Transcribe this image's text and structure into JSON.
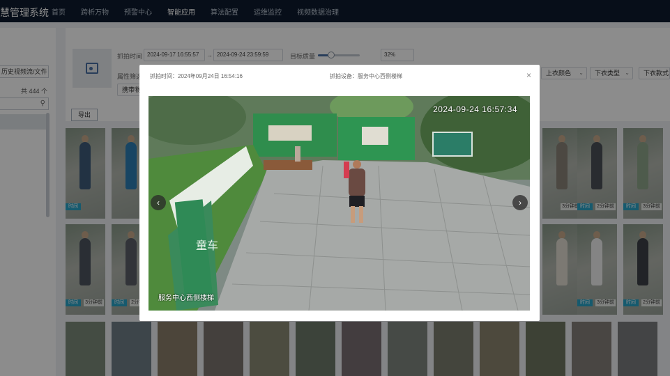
{
  "app": {
    "title": "慧管理系统"
  },
  "nav": {
    "items": [
      {
        "label": "首页",
        "active": false
      },
      {
        "label": "跨析万物",
        "active": false
      },
      {
        "label": "预警中心",
        "active": false
      },
      {
        "label": "智能应用",
        "active": true
      },
      {
        "label": "算法配置",
        "active": false
      },
      {
        "label": "运维监控",
        "active": false
      },
      {
        "label": "视频数据治理",
        "active": false
      }
    ]
  },
  "left_panel": {
    "history_button": "历史视频流/文件",
    "count_text": "共 444 个",
    "search_icon": "search-icon"
  },
  "filters": {
    "capture_time_label": "抓拍时间",
    "start_time": "2024-09-17 16:55:57",
    "separator": "→",
    "end_time": "2024-09-24 23:59:59",
    "similarity_label": "目标质量",
    "similarity_fraction": 0.32,
    "similarity_value": "32%",
    "attribute_label": "属性筛选",
    "carry_label": "携带物",
    "selects": [
      {
        "label": "上衣颜色"
      },
      {
        "label": "下衣类型"
      },
      {
        "label": "下衣款式"
      }
    ],
    "export_button": "导出"
  },
  "grid": {
    "tag_label": "时间",
    "cards_row1": [
      {
        "time": ""
      },
      {
        "time": ""
      },
      {
        "time": "3分钟前"
      },
      {
        "time": "2分钟前"
      },
      {
        "time": "3分钟前"
      }
    ],
    "cards_row2": [
      {
        "time": "3分钟前"
      },
      {
        "time": "2分钟前"
      },
      {
        "time": ""
      },
      {
        "time": ""
      },
      {
        "time": "3分钟前"
      },
      {
        "time": "2分钟前"
      },
      {
        "time": "3分钟前"
      }
    ]
  },
  "modal": {
    "capture_time": "抓拍时间：2024年09月24日 16:54:16",
    "capture_device": "抓拍设备：服务中心西侧楼梯",
    "close_icon": "close-icon",
    "video_timestamp": "2024-09-24 16:57:34",
    "video_location": "服务中心西侧楼梯",
    "sign_text": "童车",
    "prev_icon": "chevron-left-icon",
    "next_icon": "chevron-right-icon"
  }
}
